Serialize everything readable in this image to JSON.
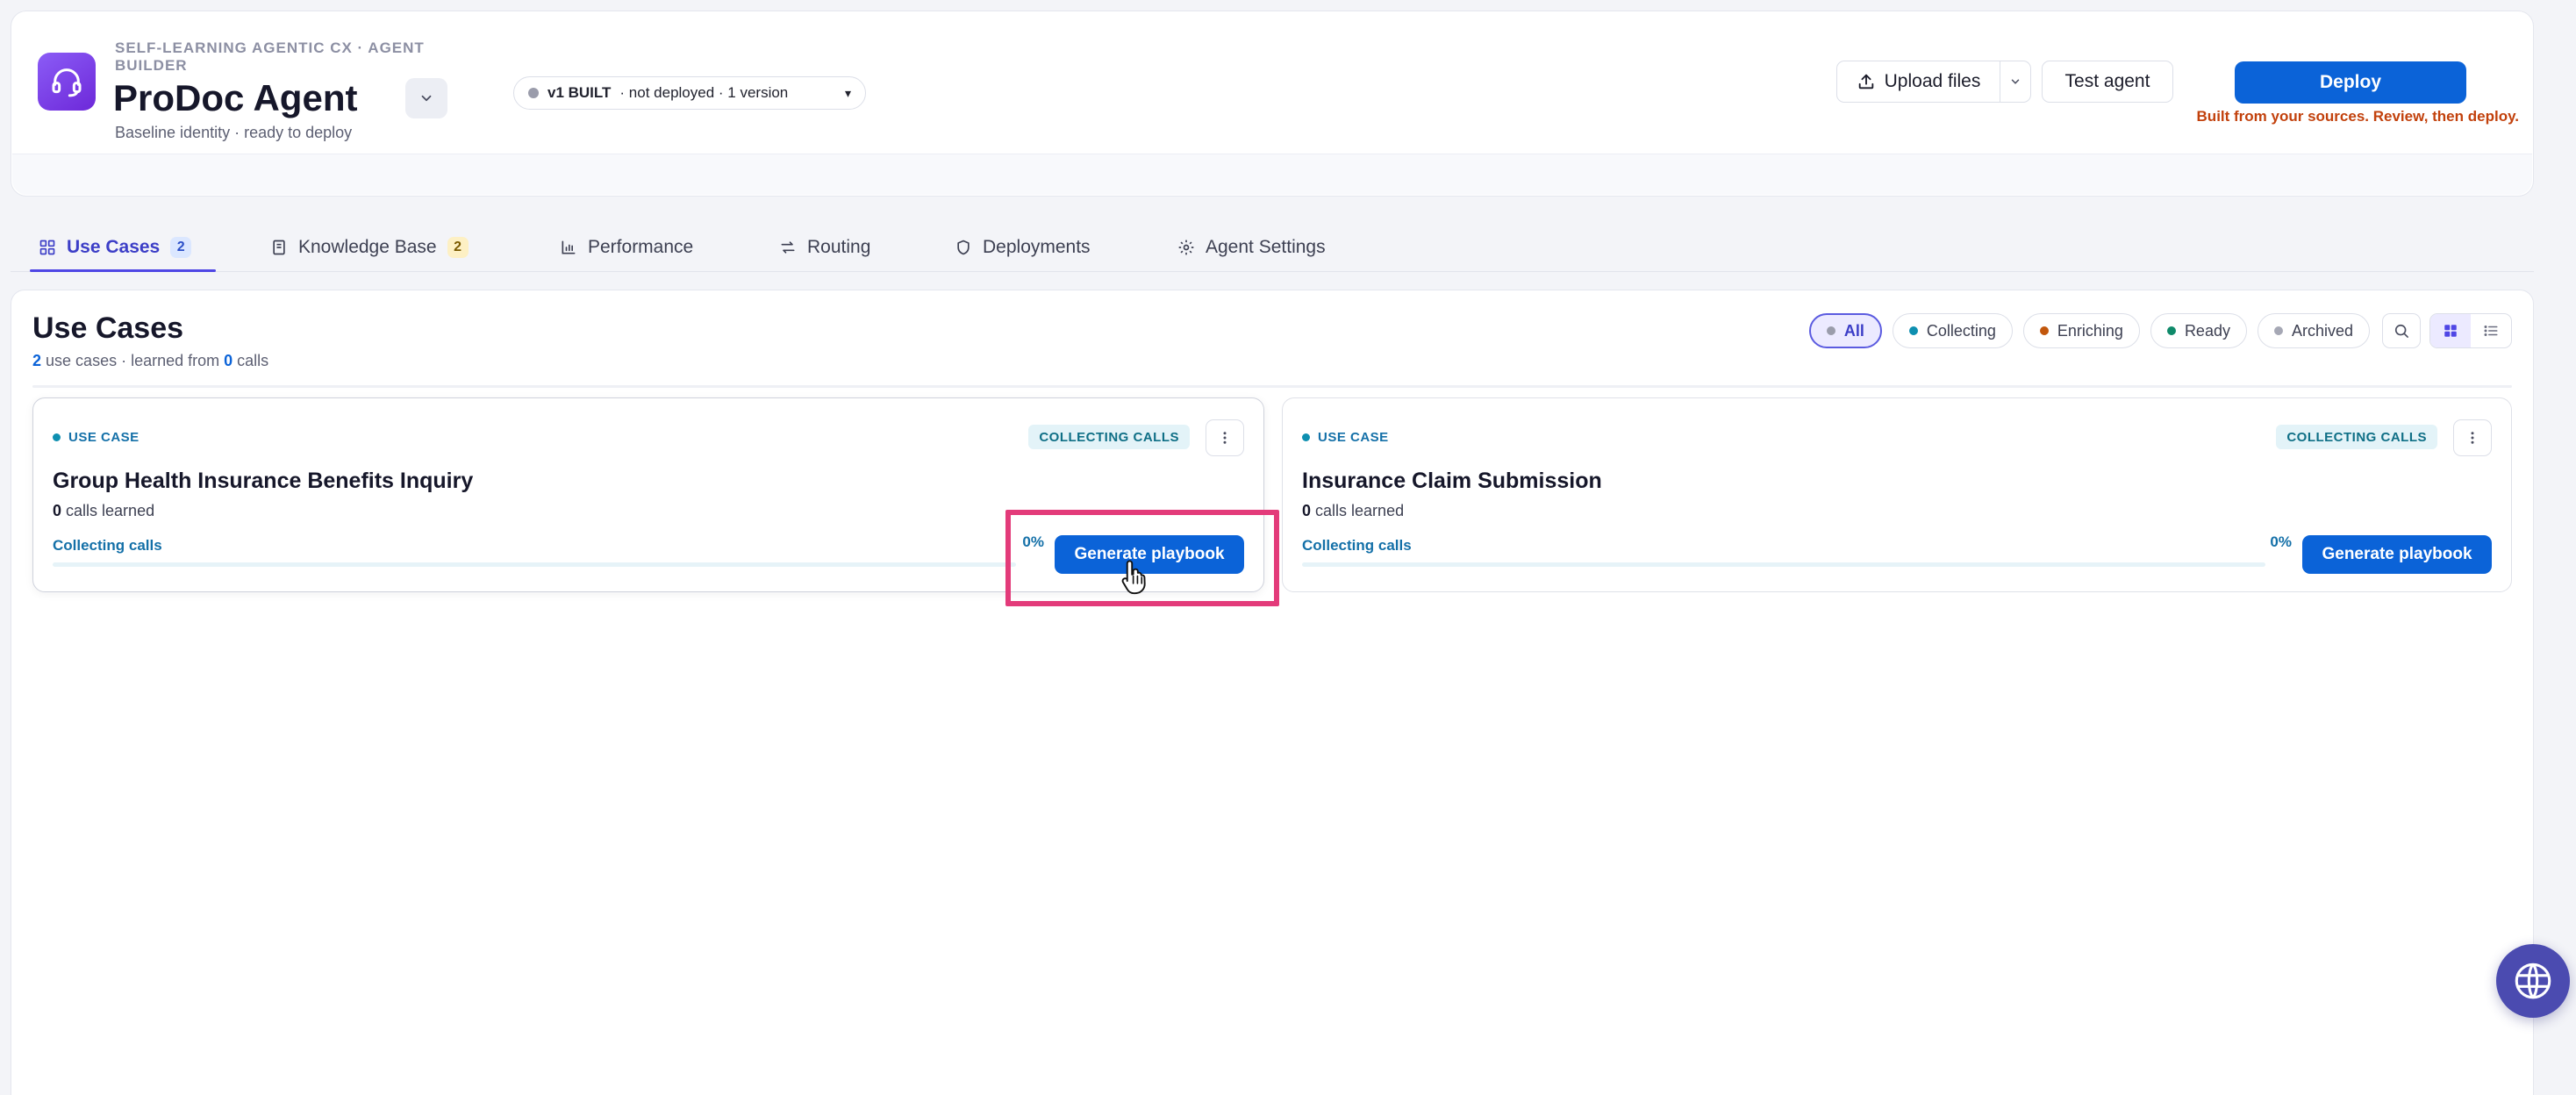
{
  "header": {
    "eyebrow": "SELF-LEARNING AGENTIC CX · AGENT BUILDER",
    "agent_name": "ProDoc Agent",
    "subtitle": "Baseline identity · ready to deploy",
    "version": {
      "label": "v1 BUILT",
      "meta": "· not deployed · 1 version",
      "status_color": "#9a9cab"
    },
    "upload_label": "Upload files",
    "test_label": "Test agent",
    "deploy_label": "Deploy",
    "deploy_hint": "Built from your sources. Review, then deploy."
  },
  "tabs": [
    {
      "label": "Use Cases",
      "badge": "2",
      "icon": "grid-icon",
      "active": true
    },
    {
      "label": "Knowledge Base",
      "badge": "2",
      "icon": "book-icon"
    },
    {
      "label": "Performance",
      "icon": "bar-chart-icon"
    },
    {
      "label": "Routing",
      "icon": "routing-arrows-icon"
    },
    {
      "label": "Deployments",
      "icon": "shield-icon"
    },
    {
      "label": "Agent Settings",
      "icon": "gear-icon"
    }
  ],
  "use_cases": {
    "title": "Use Cases",
    "summary": {
      "count": "2",
      "text_mid": "use cases · learned from",
      "calls": "0",
      "text_end": "calls"
    },
    "filters": [
      {
        "label": "All",
        "dot": "#9a9cab",
        "active": true
      },
      {
        "label": "Collecting",
        "dot": "#0e8fb0"
      },
      {
        "label": "Enriching",
        "dot": "#c2570c"
      },
      {
        "label": "Ready",
        "dot": "#0f8a6a"
      },
      {
        "label": "Archived",
        "dot": "#a6a8b5"
      }
    ],
    "cards": [
      {
        "kind": "USE CASE",
        "status": "COLLECTING CALLS",
        "title": "Group Health Insurance Benefits Inquiry",
        "calls_count": "0",
        "calls_text": "calls learned",
        "progress_label": "Collecting calls",
        "progress_pct": "0%",
        "progress": 0,
        "button": "Generate playbook"
      },
      {
        "kind": "USE CASE",
        "status": "COLLECTING CALLS",
        "title": "Insurance Claim Submission",
        "calls_count": "0",
        "calls_text": "calls learned",
        "progress_label": "Collecting calls",
        "progress_pct": "0%",
        "progress": 0,
        "button": "Generate playbook"
      }
    ]
  },
  "colors": {
    "accent": "#0b63d8",
    "brand": "#7c3aed",
    "tab_active": "#3c3ec7",
    "highlight": "#e33b7a"
  }
}
